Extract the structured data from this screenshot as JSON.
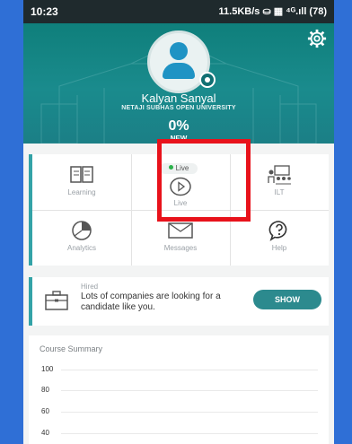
{
  "status_bar": {
    "time": "10:23",
    "indicators": "11.5KB/s ⛀ ▦ ⁴ᴳ.ıll (78)"
  },
  "profile": {
    "name": "Kalyan Sanyal",
    "university": "NETAJI SUBHAS OPEN UNIVERSITY",
    "progress_text": "0%",
    "progress_label": "NEW",
    "progress_value": 0
  },
  "menu": {
    "items": [
      {
        "label": "Learning",
        "icon": "book-icon"
      },
      {
        "label": "Live",
        "icon": "play-circle-icon",
        "badge": "Live"
      },
      {
        "label": "ILT",
        "icon": "classroom-icon"
      },
      {
        "label": "Analytics",
        "icon": "pie-chart-icon"
      },
      {
        "label": "Messages",
        "icon": "envelope-icon"
      },
      {
        "label": "Help",
        "icon": "help-bubble-icon"
      }
    ]
  },
  "hired_card": {
    "label": "Hired",
    "message": "Lots of companies are looking for a candidate like you.",
    "button": "SHOW",
    "icon": "briefcase-icon"
  },
  "course_summary": {
    "title": "Course Summary",
    "y_ticks": [
      "100",
      "80",
      "60",
      "40"
    ]
  },
  "colors": {
    "accent": "#2c8a8e",
    "header": "#1a8b8d",
    "highlight": "#e8121b",
    "page_bg": "#2f6fd6"
  }
}
